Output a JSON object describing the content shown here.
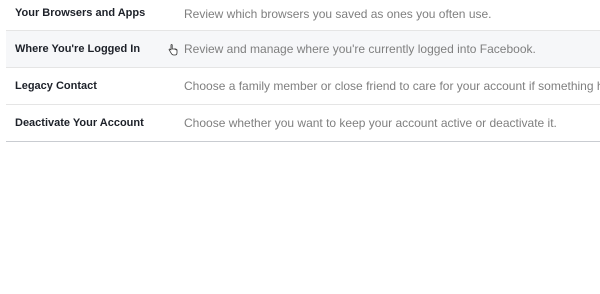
{
  "settings_rows": [
    {
      "title": "Your Browsers and Apps",
      "description": "Review which browsers you saved as ones you often use."
    },
    {
      "title": "Where You're Logged In",
      "description": "Review and manage where you're currently logged into Facebook."
    },
    {
      "title": "Legacy Contact",
      "description": "Choose a family member or close friend to care for your account if something h"
    },
    {
      "title": "Deactivate Your Account",
      "description": "Choose whether you want to keep your account active or deactivate it."
    }
  ],
  "cursor_icon": "hand-pointer-icon"
}
